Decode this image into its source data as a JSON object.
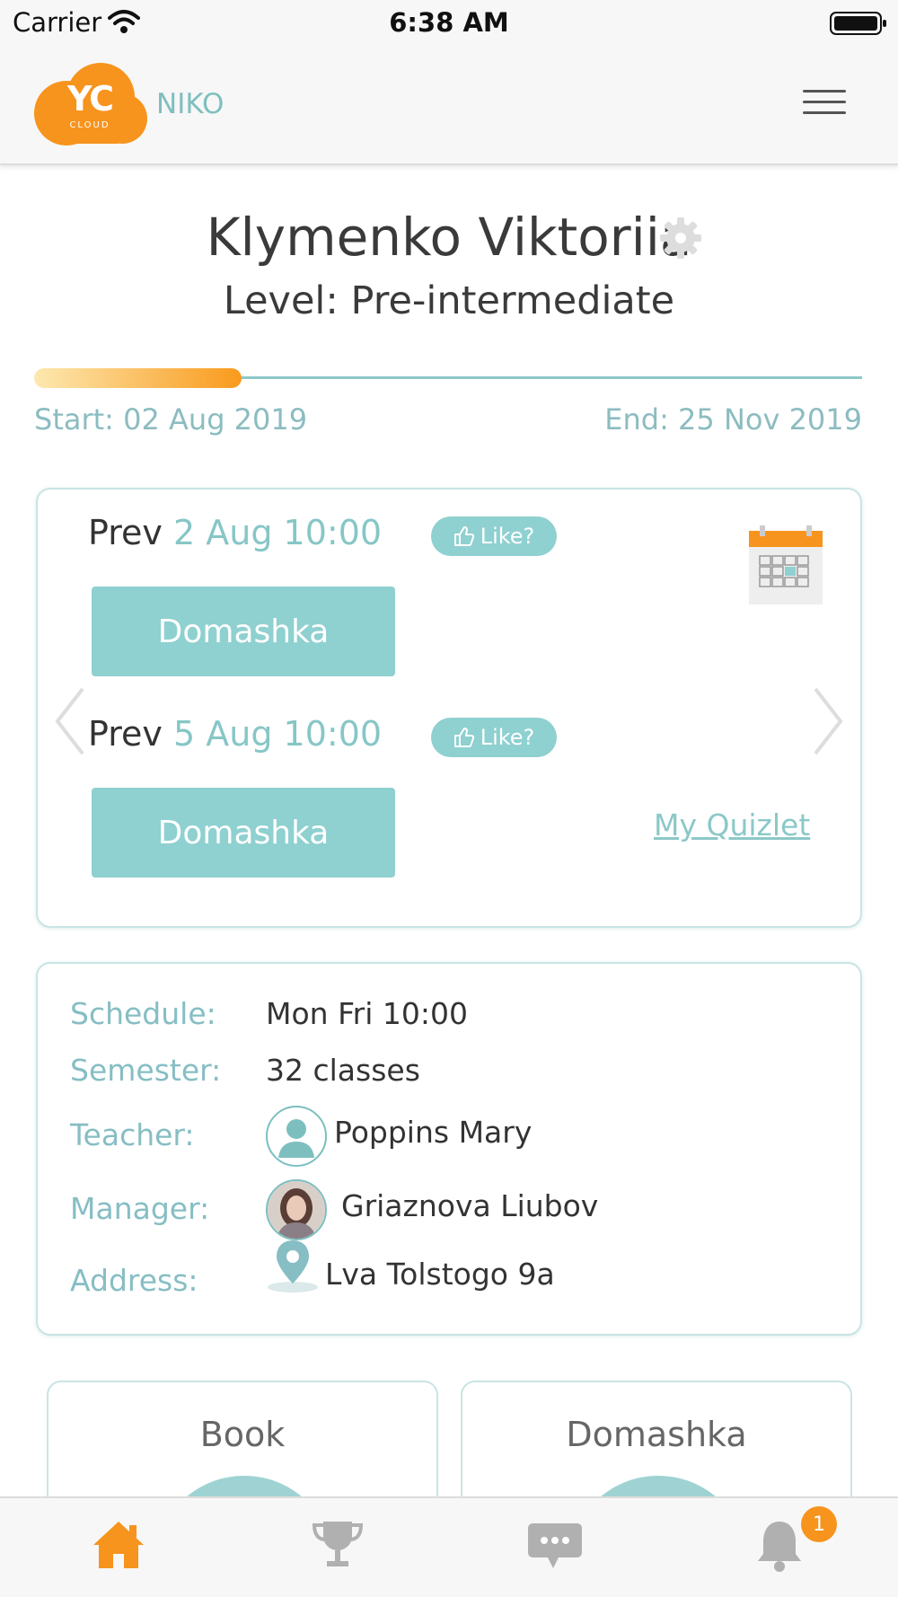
{
  "status_bar": {
    "carrier": "Carrier",
    "time": "6:38 AM"
  },
  "header": {
    "logo_text": "YC",
    "logo_sub": "CLOUD",
    "org_name": "NIKO"
  },
  "profile": {
    "name": "Klymenko Viktoriia",
    "level": "Level: Pre-intermediate"
  },
  "progress": {
    "fraction": 0.25,
    "start": "Start: 02 Aug 2019",
    "end": "End: 25 Nov 2019"
  },
  "lessons": [
    {
      "prefix": "Prev",
      "date": "2 Aug 10:00",
      "like_label": "Like?",
      "button": "Domashka"
    },
    {
      "prefix": "Prev",
      "date": "5 Aug 10:00",
      "like_label": "Like?",
      "button": "Domashka"
    }
  ],
  "quizlet_link": "My Quizlet",
  "info": {
    "schedule_label": "Schedule:",
    "schedule_value": "Mon Fri 10:00",
    "semester_label": "Semester:",
    "semester_value": "32 classes",
    "teacher_label": "Teacher:",
    "teacher_value": "Poppins Mary",
    "manager_label": "Manager:",
    "manager_value": "Griaznova Liubov",
    "address_label": "Address:",
    "address_value": "Lva Tolstogo 9a"
  },
  "tiles": [
    {
      "title": "Book"
    },
    {
      "title": "Domashka"
    }
  ],
  "tab_bar": {
    "items": [
      "home-icon",
      "trophy-icon",
      "chat-icon",
      "bell-icon"
    ],
    "notification_count": "1"
  },
  "colors": {
    "accent": "#f99a1c",
    "teal": "#8fd0d0",
    "label_teal": "#86bec4"
  }
}
